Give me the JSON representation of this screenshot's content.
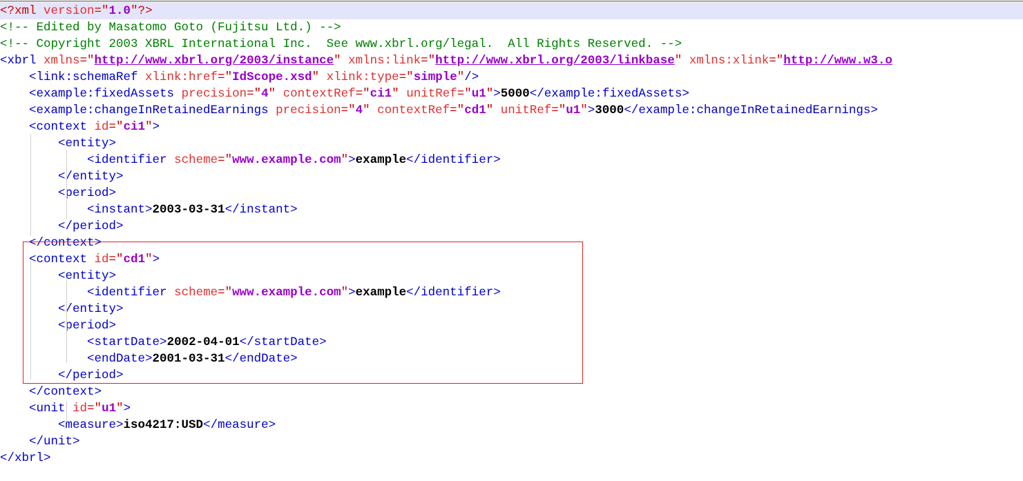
{
  "document": {
    "kind": "xml-source-view",
    "background_color": "#ffffff",
    "highlight_line_color": "#e4e4fa",
    "annotation_box_color": "#e02020",
    "syntax_colors": {
      "tag": "#0000cc",
      "processing_instruction": "#cc0000",
      "comment": "#008000",
      "attribute_name": "#e03030",
      "attribute_value": "#9900cc",
      "text_content": "#000000"
    },
    "lines": [
      {
        "id": 1,
        "indent": 0,
        "highlighted": true,
        "tokens": [
          {
            "t": "pi",
            "v": "<?xml "
          },
          {
            "t": "attr",
            "v": "version"
          },
          {
            "t": "pi",
            "v": "=\""
          },
          {
            "t": "val",
            "v": "1.0"
          },
          {
            "t": "pi",
            "v": "\"?>"
          }
        ]
      },
      {
        "id": 2,
        "indent": 0,
        "highlighted": false,
        "tokens": [
          {
            "t": "comment",
            "v": "<!-- Edited by Masatomo Goto (Fujitsu Ltd.) -->"
          }
        ]
      },
      {
        "id": 3,
        "indent": 0,
        "highlighted": false,
        "tokens": [
          {
            "t": "comment",
            "v": "<!-- Copyright 2003 XBRL International Inc.  See www.xbrl.org/legal.  All Rights Reserved. -->"
          }
        ]
      },
      {
        "id": 4,
        "indent": 0,
        "highlighted": false,
        "tokens": [
          {
            "t": "tag",
            "v": "<xbrl "
          },
          {
            "t": "attr",
            "v": "xmlns"
          },
          {
            "t": "punc",
            "v": "=\""
          },
          {
            "t": "link",
            "v": "http://www.xbrl.org/2003/instance"
          },
          {
            "t": "punc",
            "v": "\" "
          },
          {
            "t": "attr",
            "v": "xmlns:link"
          },
          {
            "t": "punc",
            "v": "=\""
          },
          {
            "t": "link",
            "v": "http://www.xbrl.org/2003/linkbase"
          },
          {
            "t": "punc",
            "v": "\" "
          },
          {
            "t": "attr",
            "v": "xmlns:xlink"
          },
          {
            "t": "punc",
            "v": "=\""
          },
          {
            "t": "link",
            "v": "http://www.w3.o"
          }
        ]
      },
      {
        "id": 5,
        "indent": 1,
        "highlighted": false,
        "tokens": [
          {
            "t": "tag",
            "v": "<link:schemaRef "
          },
          {
            "t": "attr",
            "v": "xlink:href"
          },
          {
            "t": "punc",
            "v": "=\""
          },
          {
            "t": "val",
            "v": "IdScope.xsd"
          },
          {
            "t": "punc",
            "v": "\" "
          },
          {
            "t": "attr",
            "v": "xlink:type"
          },
          {
            "t": "punc",
            "v": "=\""
          },
          {
            "t": "val",
            "v": "simple"
          },
          {
            "t": "punc",
            "v": "\""
          },
          {
            "t": "tag",
            "v": "/>"
          }
        ]
      },
      {
        "id": 6,
        "indent": 1,
        "highlighted": false,
        "tokens": [
          {
            "t": "tag",
            "v": "<example:fixedAssets "
          },
          {
            "t": "attr",
            "v": "precision"
          },
          {
            "t": "punc",
            "v": "=\""
          },
          {
            "t": "val",
            "v": "4"
          },
          {
            "t": "punc",
            "v": "\" "
          },
          {
            "t": "attr",
            "v": "contextRef"
          },
          {
            "t": "punc",
            "v": "=\""
          },
          {
            "t": "val",
            "v": "ci1"
          },
          {
            "t": "punc",
            "v": "\" "
          },
          {
            "t": "attr",
            "v": "unitRef"
          },
          {
            "t": "punc",
            "v": "=\""
          },
          {
            "t": "val",
            "v": "u1"
          },
          {
            "t": "punc",
            "v": "\""
          },
          {
            "t": "tag",
            "v": ">"
          },
          {
            "t": "text",
            "v": "5000"
          },
          {
            "t": "tag",
            "v": "</example:fixedAssets>"
          }
        ]
      },
      {
        "id": 7,
        "indent": 1,
        "highlighted": false,
        "tokens": [
          {
            "t": "tag",
            "v": "<example:changeInRetainedEarnings "
          },
          {
            "t": "attr",
            "v": "precision"
          },
          {
            "t": "punc",
            "v": "=\""
          },
          {
            "t": "val",
            "v": "4"
          },
          {
            "t": "punc",
            "v": "\" "
          },
          {
            "t": "attr",
            "v": "contextRef"
          },
          {
            "t": "punc",
            "v": "=\""
          },
          {
            "t": "val",
            "v": "cd1"
          },
          {
            "t": "punc",
            "v": "\" "
          },
          {
            "t": "attr",
            "v": "unitRef"
          },
          {
            "t": "punc",
            "v": "=\""
          },
          {
            "t": "val",
            "v": "u1"
          },
          {
            "t": "punc",
            "v": "\""
          },
          {
            "t": "tag",
            "v": ">"
          },
          {
            "t": "text",
            "v": "3000"
          },
          {
            "t": "tag",
            "v": "</example:changeInRetainedEarnings>"
          }
        ]
      },
      {
        "id": 8,
        "indent": 1,
        "highlighted": false,
        "tokens": [
          {
            "t": "tag",
            "v": "<context "
          },
          {
            "t": "attr",
            "v": "id"
          },
          {
            "t": "punc",
            "v": "=\""
          },
          {
            "t": "val",
            "v": "ci1"
          },
          {
            "t": "punc",
            "v": "\""
          },
          {
            "t": "tag",
            "v": ">"
          }
        ]
      },
      {
        "id": 9,
        "indent": 2,
        "highlighted": false,
        "tokens": [
          {
            "t": "tag",
            "v": "<entity>"
          }
        ]
      },
      {
        "id": 10,
        "indent": 3,
        "highlighted": false,
        "tokens": [
          {
            "t": "tag",
            "v": "<identifier "
          },
          {
            "t": "attr",
            "v": "scheme"
          },
          {
            "t": "punc",
            "v": "=\""
          },
          {
            "t": "val",
            "v": "www.example.com"
          },
          {
            "t": "punc",
            "v": "\""
          },
          {
            "t": "tag",
            "v": ">"
          },
          {
            "t": "text",
            "v": "example"
          },
          {
            "t": "tag",
            "v": "</identifier>"
          }
        ]
      },
      {
        "id": 11,
        "indent": 2,
        "highlighted": false,
        "tokens": [
          {
            "t": "tag",
            "v": "</entity>"
          }
        ]
      },
      {
        "id": 12,
        "indent": 2,
        "highlighted": false,
        "tokens": [
          {
            "t": "tag",
            "v": "<period>"
          }
        ]
      },
      {
        "id": 13,
        "indent": 3,
        "highlighted": false,
        "tokens": [
          {
            "t": "tag",
            "v": "<instant>"
          },
          {
            "t": "text",
            "v": "2003-03-31"
          },
          {
            "t": "tag",
            "v": "</instant>"
          }
        ]
      },
      {
        "id": 14,
        "indent": 2,
        "highlighted": false,
        "tokens": [
          {
            "t": "tag",
            "v": "</period>"
          }
        ]
      },
      {
        "id": 15,
        "indent": 1,
        "highlighted": false,
        "tokens": [
          {
            "t": "tag",
            "v": "</context>"
          }
        ]
      },
      {
        "id": 16,
        "indent": 1,
        "highlighted": false,
        "tokens": [
          {
            "t": "tag",
            "v": "<context "
          },
          {
            "t": "attr",
            "v": "id"
          },
          {
            "t": "punc",
            "v": "=\""
          },
          {
            "t": "val",
            "v": "cd1"
          },
          {
            "t": "punc",
            "v": "\""
          },
          {
            "t": "tag",
            "v": ">"
          }
        ]
      },
      {
        "id": 17,
        "indent": 2,
        "highlighted": false,
        "tokens": [
          {
            "t": "tag",
            "v": "<entity>"
          }
        ]
      },
      {
        "id": 18,
        "indent": 3,
        "highlighted": false,
        "tokens": [
          {
            "t": "tag",
            "v": "<identifier "
          },
          {
            "t": "attr",
            "v": "scheme"
          },
          {
            "t": "punc",
            "v": "=\""
          },
          {
            "t": "val",
            "v": "www.example.com"
          },
          {
            "t": "punc",
            "v": "\""
          },
          {
            "t": "tag",
            "v": ">"
          },
          {
            "t": "text",
            "v": "example"
          },
          {
            "t": "tag",
            "v": "</identifier>"
          }
        ]
      },
      {
        "id": 19,
        "indent": 2,
        "highlighted": false,
        "tokens": [
          {
            "t": "tag",
            "v": "</entity>"
          }
        ]
      },
      {
        "id": 20,
        "indent": 2,
        "highlighted": false,
        "tokens": [
          {
            "t": "tag",
            "v": "<period>"
          }
        ]
      },
      {
        "id": 21,
        "indent": 3,
        "highlighted": false,
        "tokens": [
          {
            "t": "tag",
            "v": "<startDate>"
          },
          {
            "t": "text",
            "v": "2002-04-01"
          },
          {
            "t": "tag",
            "v": "</startDate>"
          }
        ]
      },
      {
        "id": 22,
        "indent": 3,
        "highlighted": false,
        "tokens": [
          {
            "t": "tag",
            "v": "<endDate>"
          },
          {
            "t": "text",
            "v": "2001-03-31"
          },
          {
            "t": "tag",
            "v": "</endDate>"
          }
        ]
      },
      {
        "id": 23,
        "indent": 2,
        "highlighted": false,
        "tokens": [
          {
            "t": "tag",
            "v": "</period>"
          }
        ]
      },
      {
        "id": 24,
        "indent": 1,
        "highlighted": false,
        "tokens": [
          {
            "t": "tag",
            "v": "</context>"
          }
        ]
      },
      {
        "id": 25,
        "indent": 1,
        "highlighted": false,
        "tokens": [
          {
            "t": "tag",
            "v": "<unit "
          },
          {
            "t": "attr",
            "v": "id"
          },
          {
            "t": "punc",
            "v": "=\""
          },
          {
            "t": "val",
            "v": "u1"
          },
          {
            "t": "punc",
            "v": "\""
          },
          {
            "t": "tag",
            "v": ">"
          }
        ]
      },
      {
        "id": 26,
        "indent": 2,
        "highlighted": false,
        "tokens": [
          {
            "t": "tag",
            "v": "<measure>"
          },
          {
            "t": "text",
            "v": "iso4217:USD"
          },
          {
            "t": "tag",
            "v": "</measure>"
          }
        ]
      },
      {
        "id": 27,
        "indent": 1,
        "highlighted": false,
        "tokens": [
          {
            "t": "tag",
            "v": "</unit>"
          }
        ]
      },
      {
        "id": 28,
        "indent": 0,
        "highlighted": false,
        "tokens": [
          {
            "t": "tag",
            "v": "</xbrl>"
          }
        ]
      }
    ]
  }
}
